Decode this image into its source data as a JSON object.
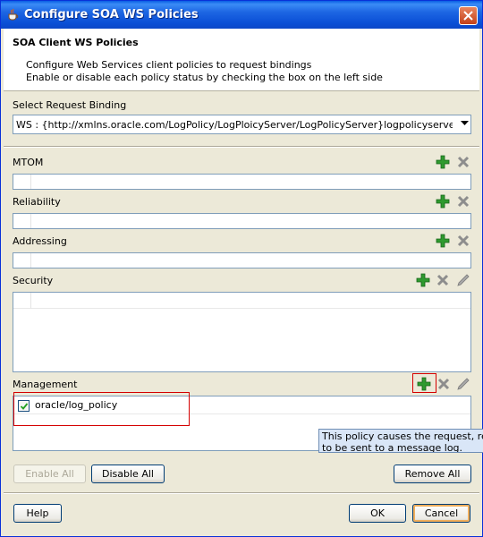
{
  "window": {
    "title": "Configure SOA WS Policies"
  },
  "header": {
    "title": "SOA Client WS Policies",
    "desc_line1": "Configure Web Services client policies to request bindings",
    "desc_line2": "Enable or disable each policy status by checking the box on the left side"
  },
  "binding": {
    "label": "Select Request Binding",
    "value": "WS : {http://xmlns.oracle.com/LogPolicy/LogPloicyServer/LogPolicyServer}logpolicyserver_client_ep ..."
  },
  "sections": {
    "mtom": {
      "label": "MTOM"
    },
    "reliability": {
      "label": "Reliability"
    },
    "addressing": {
      "label": "Addressing"
    },
    "security": {
      "label": "Security"
    },
    "management": {
      "label": "Management",
      "policies": [
        {
          "name": "oracle/log_policy",
          "enabled": true
        }
      ]
    }
  },
  "tooltip": {
    "line1": "This policy causes the request, respon",
    "line2": "to be sent to a message log."
  },
  "buttons": {
    "enable_all": "Enable All",
    "disable_all": "Disable All",
    "remove_all": "Remove All",
    "help": "Help",
    "ok": "OK",
    "cancel": "Cancel"
  },
  "colors": {
    "title_bar": "#0a4fd6",
    "add_icon": "#2f9a2f",
    "highlight": "#d40000",
    "tooltip_bg": "#d9e6f7"
  }
}
